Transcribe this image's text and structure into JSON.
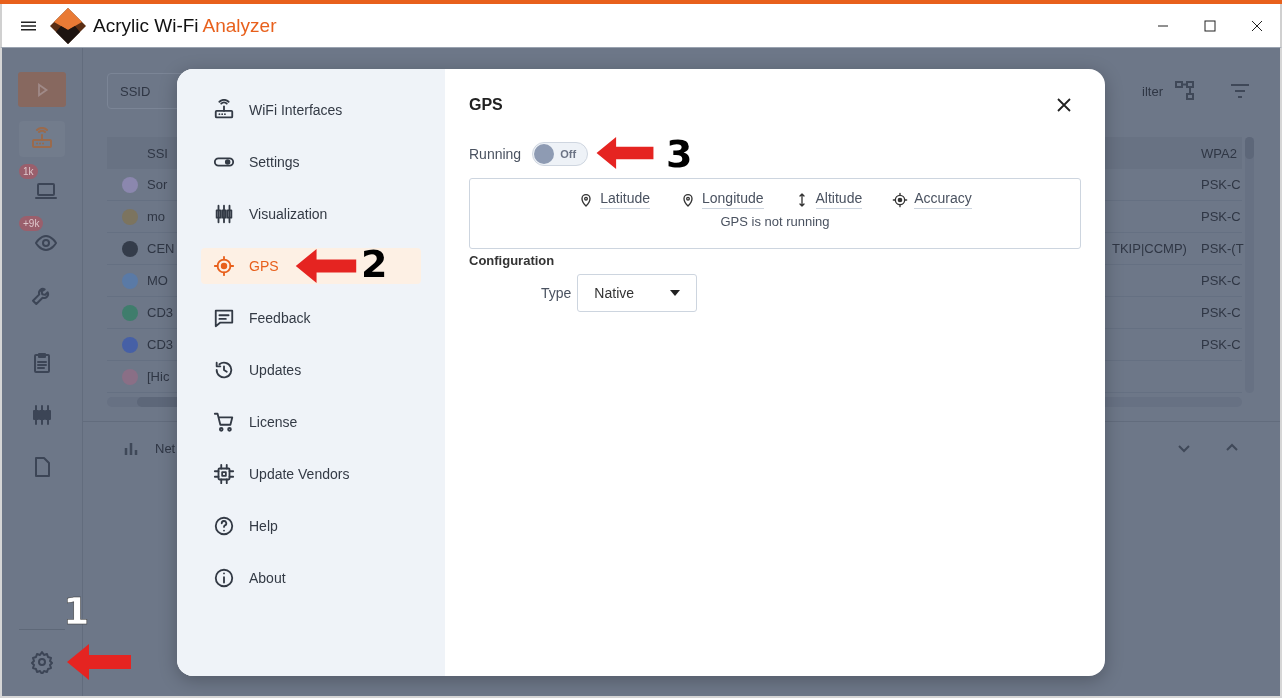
{
  "window": {
    "title_main": "Acrylic Wi-Fi",
    "title_accent": "Analyzer"
  },
  "rail": {
    "items": [
      {
        "selected": true
      },
      {
        "selected": false,
        "badge": "1k"
      },
      {
        "selected": false,
        "badge": "+9k"
      },
      {
        "selected": false
      },
      {
        "selected": false
      },
      {
        "selected": false
      },
      {
        "selected": false
      },
      {
        "selected": false,
        "callout": "1"
      }
    ]
  },
  "background": {
    "search": {
      "placeholder": "SSID"
    },
    "toolbar_text": "ilter",
    "table": {
      "header_name": "SSI",
      "header_auth": "WPA2",
      "rows": [
        {
          "name": "Sor",
          "color": "#8b87ae",
          "cipher": "",
          "auth": "PSK-C"
        },
        {
          "name": "mo",
          "color": "#7c745f",
          "cipher": "",
          "auth": "PSK-C"
        },
        {
          "name": "CEN",
          "color": "#343c4a",
          "cipher": "TKIP|CCMP)",
          "auth": "PSK-(T"
        },
        {
          "name": "MO",
          "color": "#5a7aa6",
          "cipher": "",
          "auth": "PSK-C"
        },
        {
          "name": "CD3",
          "color": "#3f7d6c",
          "cipher": "",
          "auth": "PSK-C"
        },
        {
          "name": "CD3",
          "color": "#4660a6",
          "cipher": "",
          "auth": "PSK-C"
        },
        {
          "name": "[Hic",
          "color": "#8a6f86",
          "cipher": "",
          "auth": ""
        }
      ]
    },
    "panel_title": "Net"
  },
  "dialog": {
    "nav": [
      {
        "label": "WiFi Interfaces",
        "selected": false
      },
      {
        "label": "Settings",
        "selected": false
      },
      {
        "label": "Visualization",
        "selected": false
      },
      {
        "label": "GPS",
        "selected": true,
        "callout": "2"
      },
      {
        "label": "Feedback",
        "selected": false
      },
      {
        "label": "Updates",
        "selected": false
      },
      {
        "label": "License",
        "selected": false
      },
      {
        "label": "Update Vendors",
        "selected": false
      },
      {
        "label": "Help",
        "selected": false
      },
      {
        "label": "About",
        "selected": false
      }
    ],
    "title": "GPS",
    "running": {
      "label": "Running",
      "on": false,
      "state_text": "Off",
      "callout": "3"
    },
    "fields": [
      {
        "label": "Latitude"
      },
      {
        "label": "Longitude"
      },
      {
        "label": "Altitude"
      },
      {
        "label": "Accuracy"
      }
    ],
    "status": "GPS is not running",
    "configuration": {
      "heading": "Configuration",
      "type_label": "Type",
      "type_value": "Native"
    }
  }
}
